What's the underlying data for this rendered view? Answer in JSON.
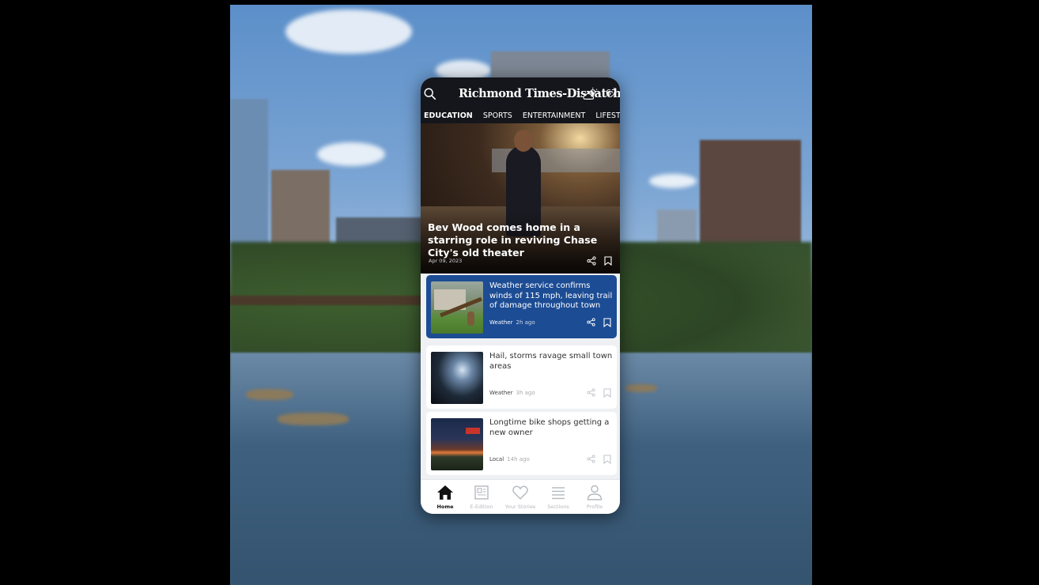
{
  "app": {
    "masthead": "Richmond Times-Dispatch",
    "temperature": "67",
    "icons": {
      "search": "search-icon",
      "weather": "partly-cloudy-icon"
    }
  },
  "nav": {
    "tabs": [
      "EDUCATION",
      "SPORTS",
      "ENTERTAINMENT",
      "LIFESTYLE"
    ]
  },
  "hero": {
    "title": "Bev Wood comes home in a starring role in reviving Chase City's old theater",
    "date": "Apr 09, 2023"
  },
  "articles": [
    {
      "title": "Weather service confirms winds of 115 mph, leaving trail of damage throughout town",
      "category": "Weather",
      "time": "2h ago"
    },
    {
      "title": "Hail, storms ravage small town areas",
      "category": "Weather",
      "time": "3h ago"
    },
    {
      "title": "Longtime bike shops getting a new owner",
      "category": "Local",
      "time": "14h ago"
    }
  ],
  "tabbar": {
    "items": [
      {
        "label": "Home"
      },
      {
        "label": "E-Edition"
      },
      {
        "label": "Your Stories"
      },
      {
        "label": "Sections"
      },
      {
        "label": "Profile"
      }
    ]
  },
  "colors": {
    "accent": "#1c4c94",
    "topbar": "#14161b"
  }
}
